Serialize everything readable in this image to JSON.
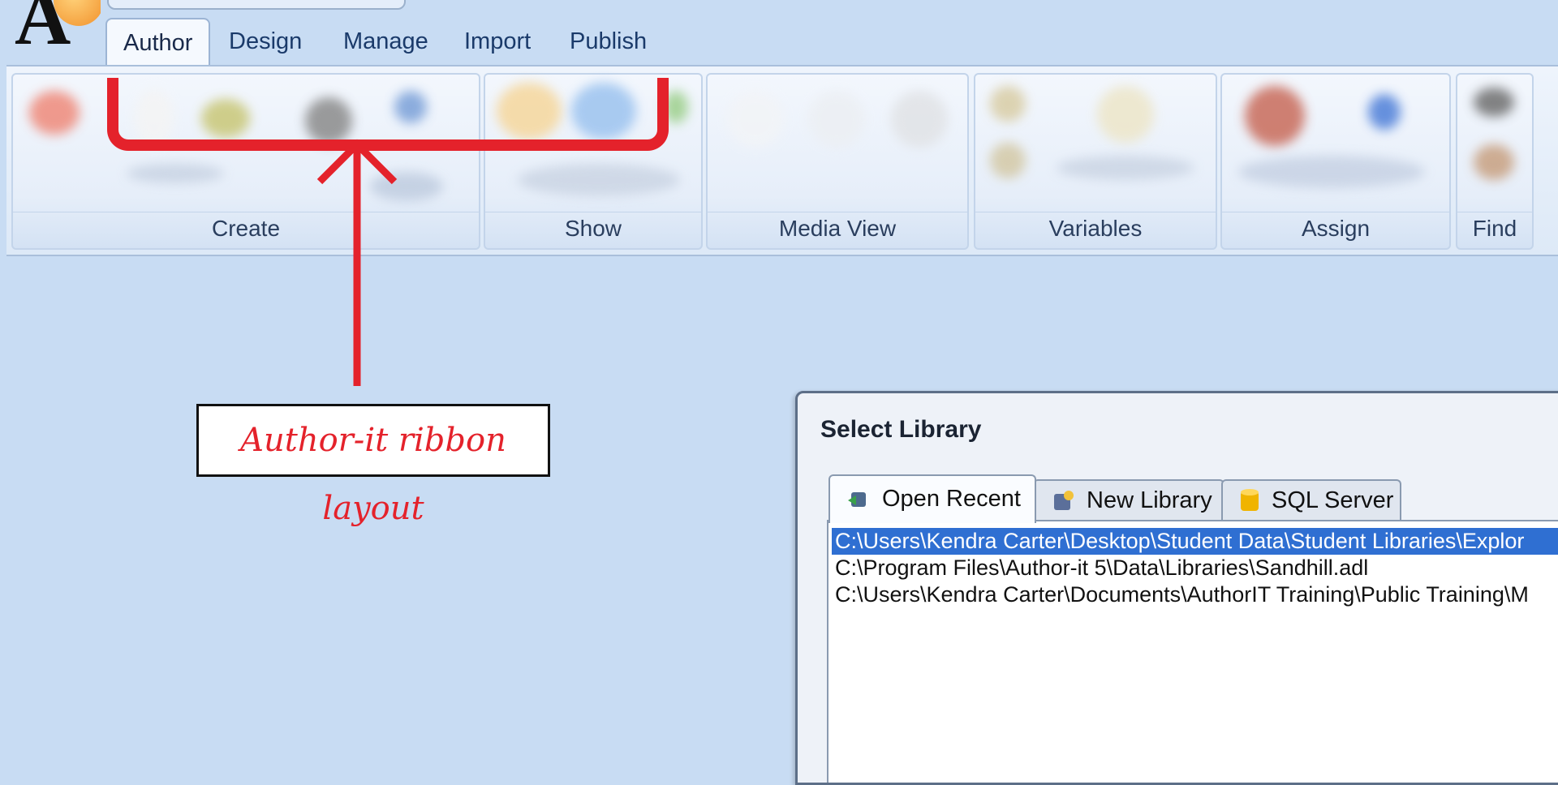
{
  "app": {
    "logo_letter": "A",
    "tabs": [
      {
        "label": "Author",
        "active": true
      },
      {
        "label": "Design",
        "active": false
      },
      {
        "label": "Manage",
        "active": false
      },
      {
        "label": "Import",
        "active": false
      },
      {
        "label": "Publish",
        "active": false
      }
    ]
  },
  "ribbon": {
    "groups": [
      {
        "label": "Create"
      },
      {
        "label": "Show"
      },
      {
        "label": "Media View"
      },
      {
        "label": "Variables"
      },
      {
        "label": "Assign"
      },
      {
        "label": "Find"
      }
    ]
  },
  "annotation": {
    "text": "Author-it ribbon layout",
    "color": "#e4222b"
  },
  "dialog": {
    "title": "Select Library",
    "tabs": [
      {
        "label": "Open Recent",
        "icon": "open-recent-icon",
        "active": true
      },
      {
        "label": "New Library",
        "icon": "new-library-icon",
        "active": false
      },
      {
        "label": "SQL Server",
        "icon": "database-icon",
        "active": false
      }
    ],
    "recent_files": [
      {
        "path": "C:\\Users\\Kendra Carter\\Desktop\\Student Data\\Student Libraries\\Explor",
        "selected": true
      },
      {
        "path": "C:\\Program Files\\Author-it 5\\Data\\Libraries\\Sandhill.adl",
        "selected": false
      },
      {
        "path": "C:\\Users\\Kendra Carter\\Documents\\AuthorIT Training\\Public Training\\M",
        "selected": false
      }
    ],
    "selection_color": "#2f6fd2"
  }
}
